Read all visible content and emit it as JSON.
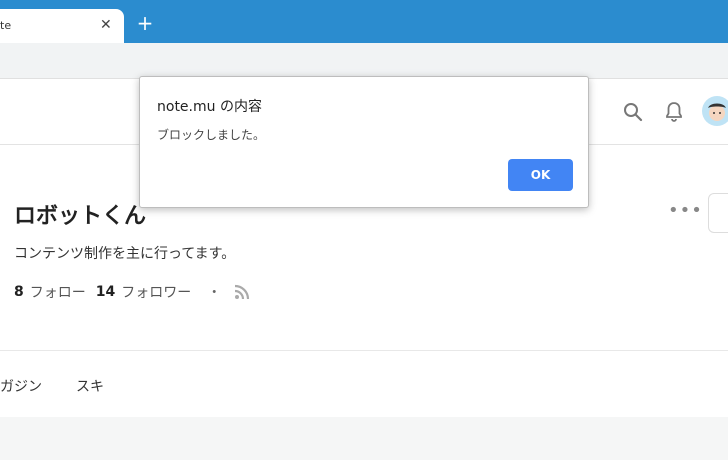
{
  "browser": {
    "tab_title": "te",
    "tab_close": "✕",
    "new_tab": "+"
  },
  "header": {
    "search_icon": "search-icon",
    "bell_icon": "bell-icon",
    "avatar_icon": "avatar-icon"
  },
  "profile": {
    "name": "ロボットくん",
    "bio": "コンテンツ制作を主に行ってます。",
    "follow_count": "8",
    "follow_label": "フォロー",
    "follower_count": "14",
    "follower_label": "フォロワー",
    "separator": "・",
    "more": "•••"
  },
  "nav_tabs": [
    {
      "label": "ガジン"
    },
    {
      "label": "スキ"
    }
  ],
  "dialog": {
    "title": "note.mu の内容",
    "message": "ブロックしました。",
    "ok_label": "OK"
  },
  "colors": {
    "tabstrip": "#2b8ccf",
    "ok_button": "#4285f4"
  }
}
